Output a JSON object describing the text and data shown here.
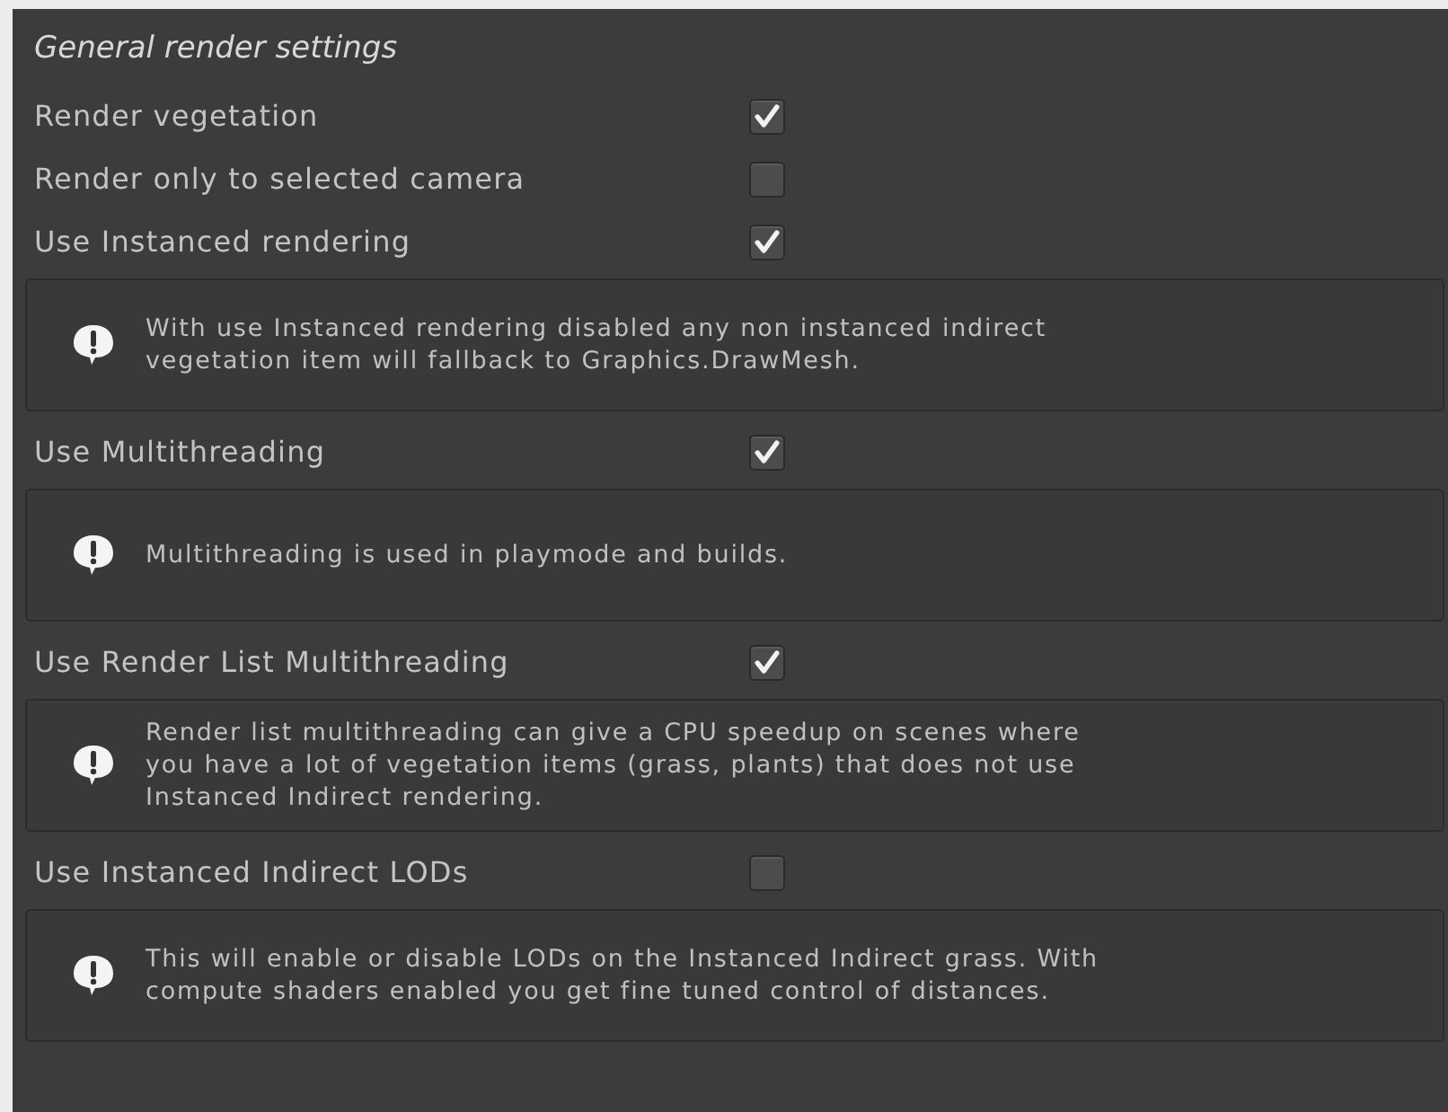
{
  "section": {
    "title": "General render settings"
  },
  "items": [
    {
      "kind": "toggle",
      "label": "Render vegetation",
      "checked": true
    },
    {
      "kind": "toggle",
      "label": "Render only to selected camera",
      "checked": false
    },
    {
      "kind": "toggle",
      "label": "Use Instanced rendering",
      "checked": true
    },
    {
      "kind": "help",
      "lines": [
        "With use Instanced rendering disabled any non instanced indirect",
        "vegetation item will fallback to Graphics.DrawMesh."
      ]
    },
    {
      "kind": "toggle",
      "label": "Use Multithreading",
      "checked": true
    },
    {
      "kind": "help",
      "lines": [
        "Multithreading is used in playmode and builds."
      ]
    },
    {
      "kind": "toggle",
      "label": "Use Render List Multithreading",
      "checked": true
    },
    {
      "kind": "help",
      "lines": [
        "Render list multithreading can give a CPU speedup on scenes where",
        "you have a lot of vegetation items (grass, plants) that does not use",
        "Instanced Indirect rendering."
      ]
    },
    {
      "kind": "toggle",
      "label": "Use Instanced Indirect LODs",
      "checked": false
    },
    {
      "kind": "help",
      "lines": [
        "This will enable or disable LODs on the Instanced Indirect grass. With",
        "compute shaders enabled you get fine tuned control of distances."
      ]
    }
  ]
}
